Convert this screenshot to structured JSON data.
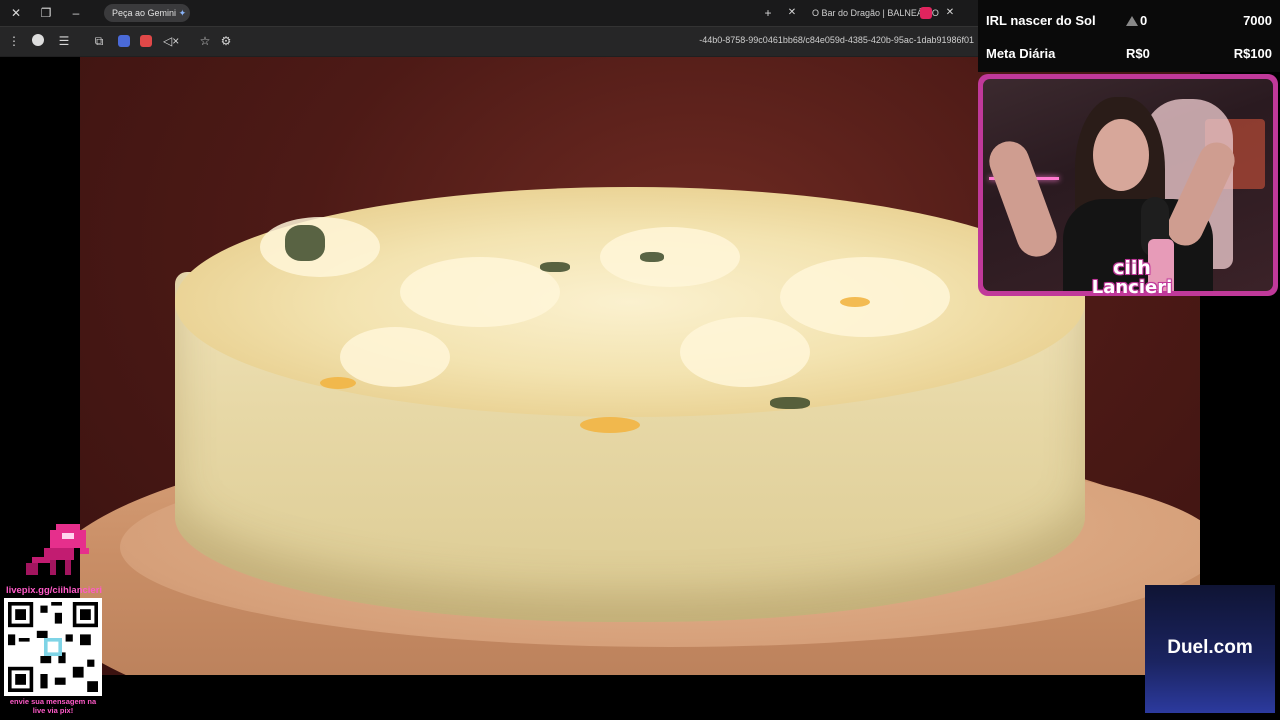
{
  "browser": {
    "tabs": [
      {
        "label": "Peça ao Gemini",
        "icon": "gemini-star-icon"
      },
      {
        "label": "O Bar do Dragão | BALNEÁRIO",
        "icon": "tab-favicon"
      }
    ],
    "url": "-44b0-8758-99c0461bb68/c84e059d-4385-420b-95ac-1dab91986f01",
    "window_controls": [
      "close-icon",
      "maximize-icon",
      "minimize-icon"
    ]
  },
  "stats": {
    "row1": {
      "label": "IRL nascer do Sol",
      "value": "0",
      "goal": "7000"
    },
    "row2": {
      "label": "Meta Diária",
      "value": "R$0",
      "goal": "R$100"
    }
  },
  "webcam": {
    "logo_line1": "ciih",
    "logo_line2": "Lancieri"
  },
  "pix": {
    "link": "livepix.gg/ciihlancieri",
    "note_line1": "envie sua mensagem na",
    "note_line2": "live via pix!"
  },
  "ad": {
    "text": "Duel.com"
  },
  "colors": {
    "accent_pink": "#ff5ac8",
    "webcam_border": "#c0399a",
    "ad_blue": "#1b2461"
  }
}
